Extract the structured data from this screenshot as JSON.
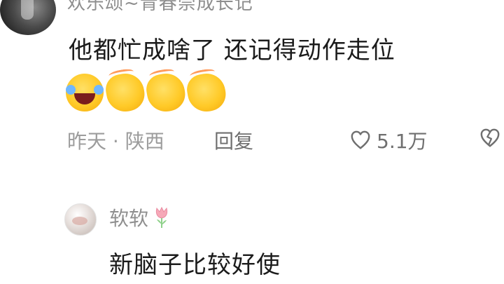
{
  "top_comment": {
    "username": "欢乐颂~青春崇成长记",
    "text": "他都忙成啥了 还记得动作走位",
    "emojis": [
      "face-with-tears-of-joy-emoji",
      "clapping-hands-emoji",
      "clapping-hands-emoji",
      "clapping-hands-emoji"
    ],
    "time_location": "昨天 · 陕西",
    "reply_label": "回复",
    "like_count": "5.1万"
  },
  "reply": {
    "username": "软软",
    "text": "新脑子比较好使"
  },
  "colors": {
    "text_primary": "#1b1b1b",
    "text_secondary": "#8e8e8e",
    "icon": "#6f6f6f",
    "emoji_yellow": "#ffca28",
    "tulip_pink": "#f6a9b8",
    "leaf_green": "#8fd18a"
  }
}
